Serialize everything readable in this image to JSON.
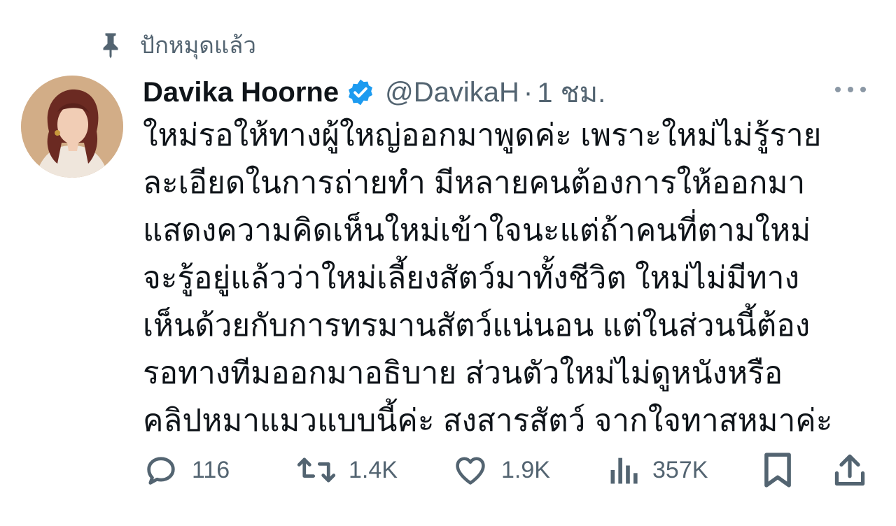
{
  "pinned": {
    "label": "ปักหมุดแล้ว",
    "icon": "pin-icon"
  },
  "author": {
    "display_name": "Davika Hoorne",
    "verified_icon": "verified-badge-icon",
    "handle": "@DavikaH",
    "separator": "·",
    "time": "1 ชม."
  },
  "tweet": {
    "lines": [
      "ใหม่รอให้ทางผู้ใหญ่ออกมาพูดค่ะ เพราะใหม่ไม่รู้ราย",
      "ละเอียดในการถ่ายทำ มีหลายคนต้องการให้ออกมา",
      "แสดงความคิดเห็นใหม่เข้าใจนะแต่ถ้าคนที่ตามใหม่",
      "จะรู้อยู่แล้วว่าใหม่เลี้ยงสัตว์มาทั้งชีวิต ใหม่ไม่มีทาง",
      "เห็นด้วยกับการทรมานสัตว์แน่นอน แต่ในส่วนนี้ต้อง",
      "รอทางทีมออกมาอธิบาย ส่วนตัวใหม่ไม่ดูหนังหรือ",
      "คลิปหมาแมวแบบนี้ค่ะ สงสารสัตว์ จากใจทาสหมาค่ะ"
    ]
  },
  "actions": {
    "reply": {
      "icon": "reply-icon",
      "count": "116"
    },
    "retweet": {
      "icon": "retweet-icon",
      "count": "1.4K"
    },
    "like": {
      "icon": "heart-icon",
      "count": "1.9K"
    },
    "views": {
      "icon": "views-icon",
      "count": "357K"
    },
    "bookmark": {
      "icon": "bookmark-icon"
    },
    "share": {
      "icon": "share-icon"
    }
  },
  "colors": {
    "text_primary": "#0f1419",
    "text_secondary": "#536471",
    "verified_blue": "#1d9bf0",
    "background": "#ffffff"
  }
}
